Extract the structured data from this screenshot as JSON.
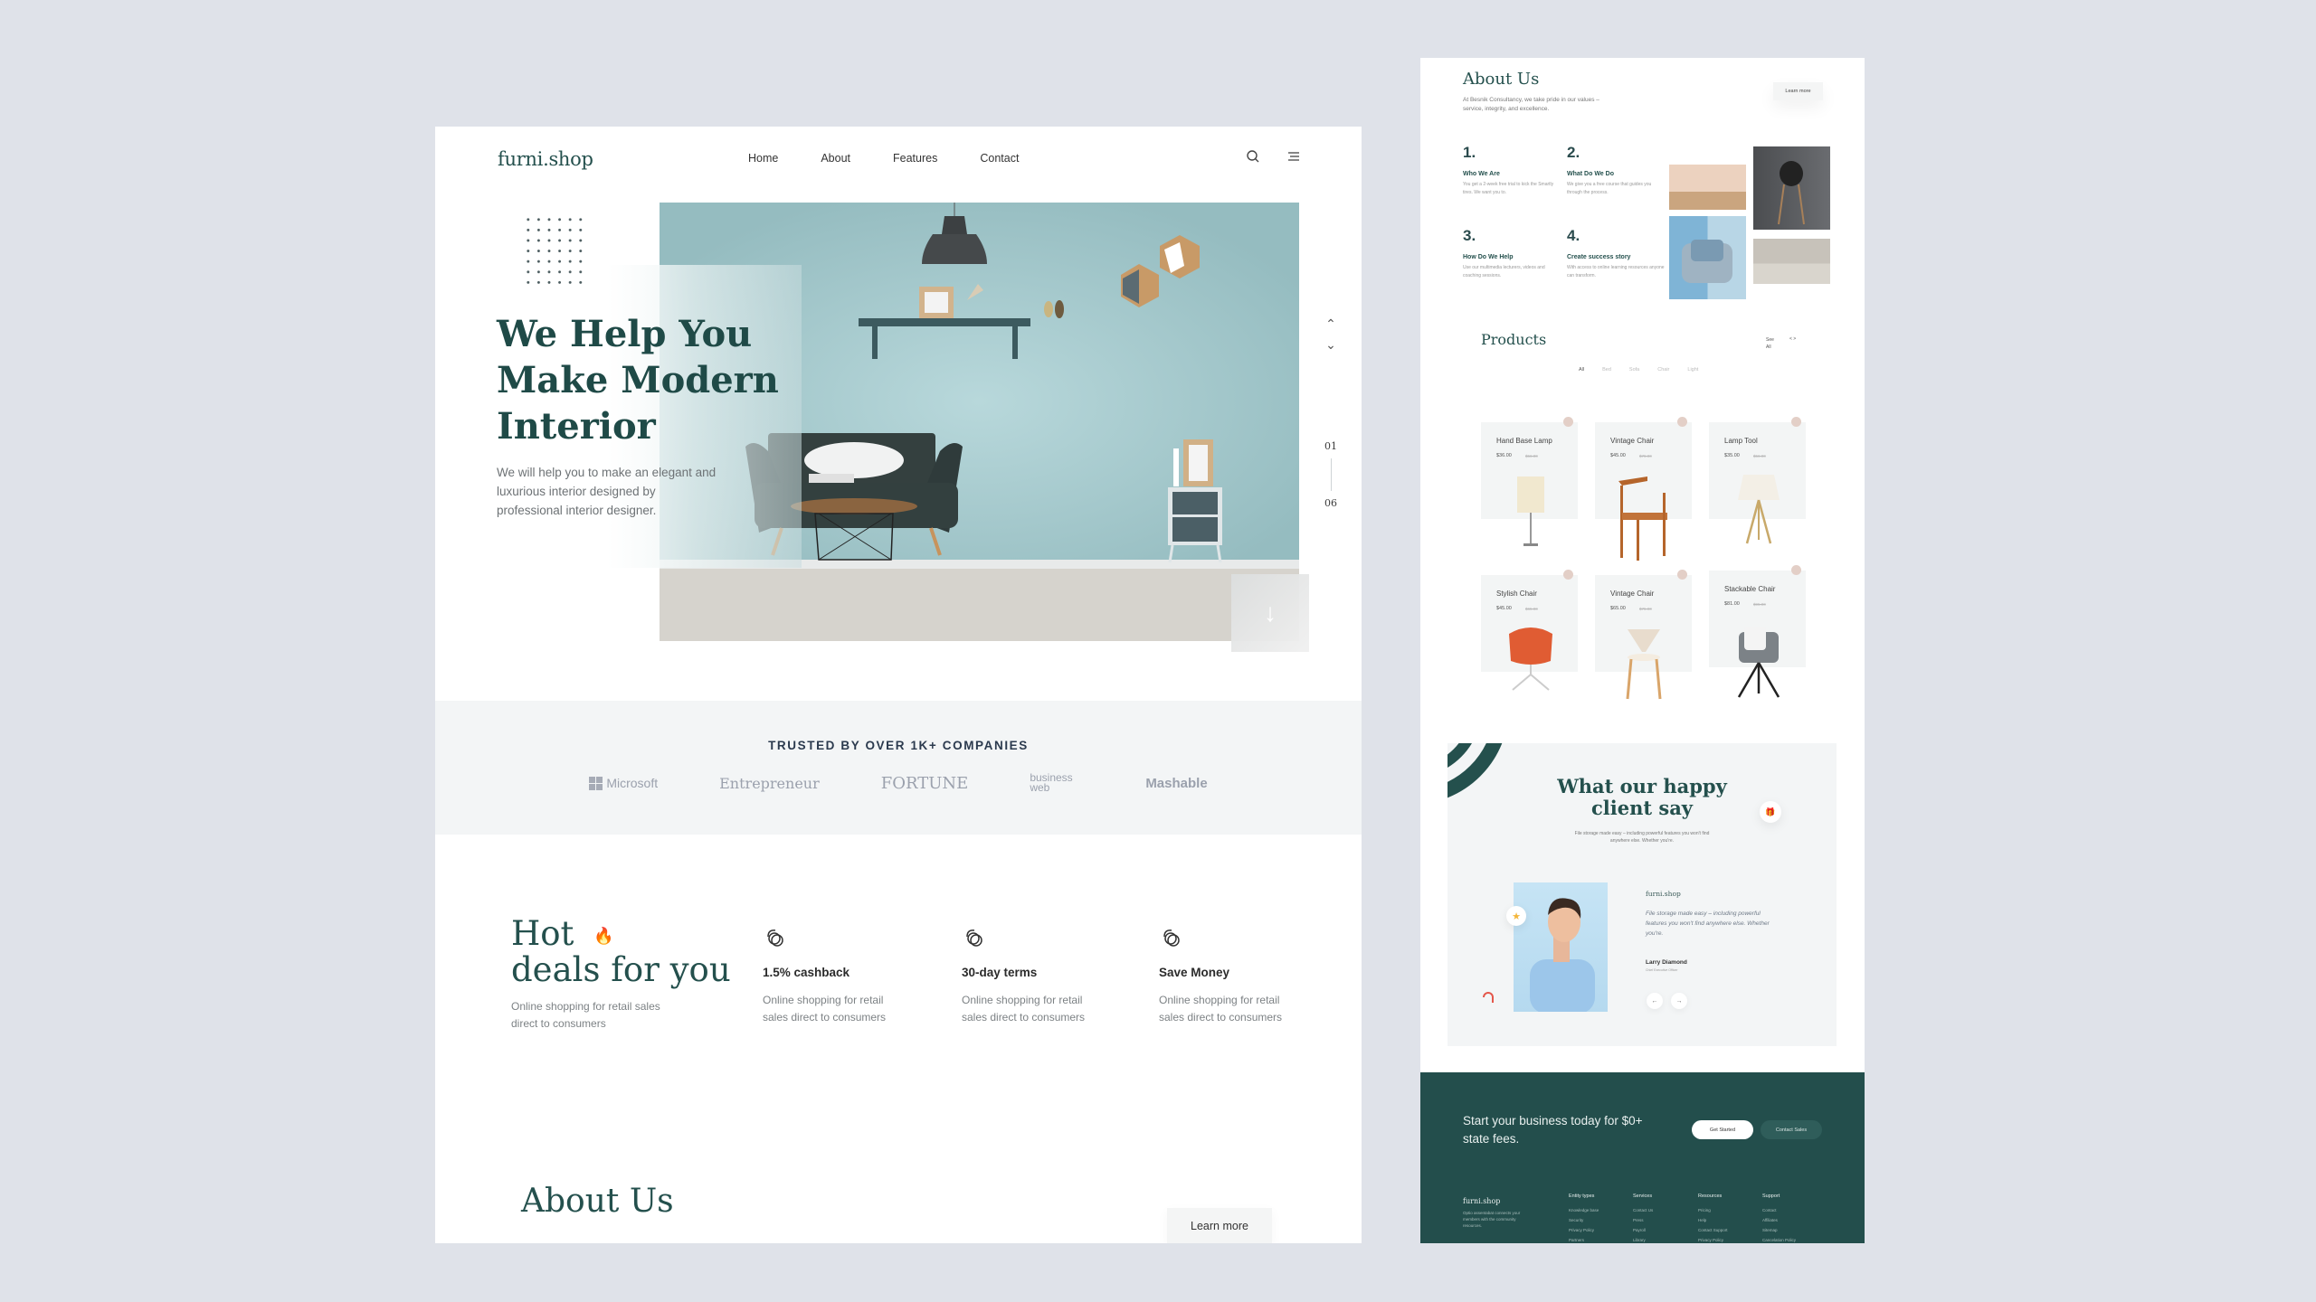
{
  "left_page": {
    "nav": {
      "logo": "furni.shop",
      "items": [
        "Home",
        "About",
        "Features",
        "Contact"
      ],
      "icons": [
        "search-icon",
        "menu-icon"
      ]
    },
    "hero": {
      "title_lines": [
        "We Help You",
        "Make Modern",
        "Interior"
      ],
      "subtitle": "We will help you to make an elegant and luxurious interior designed by professional interior designer.",
      "pager": {
        "current": "01",
        "total": "06"
      },
      "scroll_icon": "arrow-down-icon"
    },
    "trusted": {
      "title": "TRUSTED BY OVER 1K+ COMPANIES",
      "brands": [
        "Microsoft",
        "Entrepreneur",
        "FORTUNE",
        "business web",
        "Mashable"
      ]
    },
    "deals": {
      "title_line1": "Hot",
      "title_line2": "deals for you",
      "subtitle": "Online shopping for retail sales direct to consumers",
      "features": [
        {
          "title": "1.5% cashback",
          "desc": "Online shopping for retail sales direct to consumers"
        },
        {
          "title": "30-day terms",
          "desc": "Online shopping for retail sales direct to consumers"
        },
        {
          "title": "Save Money",
          "desc": "Online shopping for retail sales direct to consumers"
        }
      ]
    },
    "about": {
      "title": "About Us",
      "button": "Learn more"
    }
  },
  "right_page": {
    "about": {
      "title": "About Us",
      "subtitle": "At Besnik Consultancy, we take pride in our values – service, integrity, and excellence.",
      "button": "Learn more",
      "steps": [
        {
          "num": "1.",
          "title": "Who We Are",
          "desc": "You get a 2-week free trial to kick the Smartly tires. We want you to."
        },
        {
          "num": "2.",
          "title": "What Do We Do",
          "desc": "We give you a free course that guides you through the process."
        },
        {
          "num": "3.",
          "title": "How Do We Help",
          "desc": "Use our multimedia lecturers, videos and coaching sessions."
        },
        {
          "num": "4.",
          "title": "Create success story",
          "desc": "With access to online learning resources anyone can transform."
        }
      ]
    },
    "products": {
      "title": "Products",
      "see_all": "See All",
      "pager": "<  >",
      "filters": [
        "All",
        "Bed",
        "Sofa",
        "Chair",
        "Light"
      ],
      "items": [
        {
          "name": "Hand Base Lamp",
          "price": "$36.00",
          "old_price": "$56.00"
        },
        {
          "name": "Vintage Chair",
          "price": "$45.00",
          "old_price": "$75.00"
        },
        {
          "name": "Lamp Tool",
          "price": "$35.00",
          "old_price": "$56.00"
        },
        {
          "name": "Stylish Chair",
          "price": "$45.00",
          "old_price": "$65.00"
        },
        {
          "name": "Vintage Chair",
          "price": "$65.00",
          "old_price": "$75.00"
        },
        {
          "name": "Stackable Chair",
          "price": "$81.00",
          "old_price": "$95.00"
        }
      ]
    },
    "testimonial": {
      "title": "What our happy client say",
      "subtitle": "File storage made easy – including powerful features you won't find anywhere else. Whether you're.",
      "brand": "furni.shop",
      "quote": "File storage made easy – including powerful features you won't find anywhere else. Whether you're.",
      "name": "Larry Diamond",
      "role": "Chief Executive Officer",
      "prev": "←",
      "next": "→"
    },
    "cta": {
      "text": "Start your business today for $0+ state fees.",
      "primary": "Get Started",
      "secondary": "Contact Sales"
    },
    "footer": {
      "logo": "furni.shop",
      "desc": "Optio assentabat connects your members with the community resources.",
      "columns": [
        {
          "heading": "Entity types",
          "items": [
            "Knowledge base",
            "Security",
            "Privacy Policy",
            "Partners"
          ]
        },
        {
          "heading": "Services",
          "items": [
            "Contact Us",
            "Press",
            "Payroll",
            "Library"
          ]
        },
        {
          "heading": "Resources",
          "items": [
            "Pricing",
            "Help",
            "Contact Support",
            "Privacy Policy"
          ]
        },
        {
          "heading": "Support",
          "items": [
            "Contact",
            "Affiliates",
            "Sitemap",
            "Cancelation Policy"
          ]
        }
      ]
    }
  },
  "colors": {
    "brand_dark": "#24504d",
    "background": "#dfe2e9",
    "hero_wall": "#9bc0c4",
    "panel_light": "#f3f5f6"
  }
}
